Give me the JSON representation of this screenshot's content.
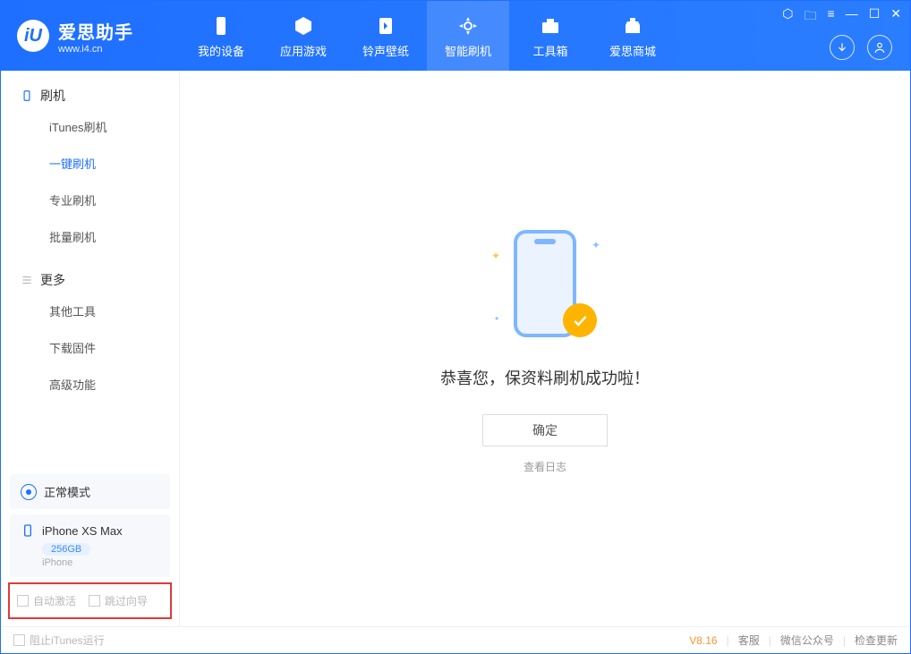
{
  "app": {
    "title": "爱思助手",
    "subtitle": "www.i4.cn"
  },
  "nav": {
    "tabs": [
      {
        "label": "我的设备",
        "icon": "device-icon"
      },
      {
        "label": "应用游戏",
        "icon": "cube-icon"
      },
      {
        "label": "铃声壁纸",
        "icon": "music-icon"
      },
      {
        "label": "智能刷机",
        "icon": "refresh-icon",
        "active": true
      },
      {
        "label": "工具箱",
        "icon": "toolbox-icon"
      },
      {
        "label": "爱思商城",
        "icon": "store-icon"
      }
    ]
  },
  "sidebar": {
    "section1": {
      "label": "刷机"
    },
    "items1": [
      {
        "label": "iTunes刷机"
      },
      {
        "label": "一键刷机",
        "active": true
      },
      {
        "label": "专业刷机"
      },
      {
        "label": "批量刷机"
      }
    ],
    "section2": {
      "label": "更多"
    },
    "items2": [
      {
        "label": "其他工具"
      },
      {
        "label": "下载固件"
      },
      {
        "label": "高级功能"
      }
    ],
    "mode": {
      "label": "正常模式"
    },
    "device": {
      "name": "iPhone XS Max",
      "storage": "256GB",
      "type": "iPhone"
    },
    "checkboxes": {
      "auto_activate": "自动激活",
      "skip_guide": "跳过向导"
    }
  },
  "main": {
    "success_text": "恭喜您，保资料刷机成功啦！",
    "ok_button": "确定",
    "log_link": "查看日志"
  },
  "footer": {
    "block_itunes": "阻止iTunes运行",
    "version": "V8.16",
    "links": {
      "service": "客服",
      "wechat": "微信公众号",
      "update": "检查更新"
    }
  }
}
